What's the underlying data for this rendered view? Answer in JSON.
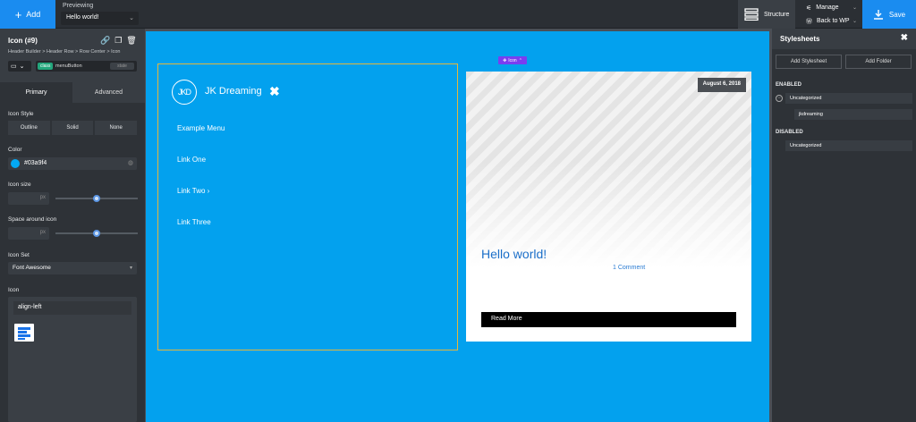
{
  "topbar": {
    "add_label": "Add",
    "previewing_label": "Previewing",
    "preview_value": "Hello world!",
    "structure_label": "Structure",
    "manage_label": "Manage",
    "back_label": "Back to WP",
    "save_label": "Save"
  },
  "left": {
    "title": "Icon (#9)",
    "breadcrumb": "Header Builder > Header Row > Row Center > Icon",
    "class_tag": "class",
    "class_value": "menuButton",
    "state_label": "state",
    "tabs": [
      "Primary",
      "Advanced"
    ],
    "icon_style_label": "Icon Style",
    "icon_style_options": [
      "Outline",
      "Solid",
      "None"
    ],
    "color_label": "Color",
    "color_value": "#03a9f4",
    "icon_size_label": "Icon size",
    "icon_size_unit": "px",
    "icon_size_level": 0.5,
    "space_label": "Space around icon",
    "space_unit": "px",
    "space_level": 0.5,
    "icon_set_label": "Icon Set",
    "icon_set_value": "Font Awesome",
    "icon_label": "Icon",
    "icon_search_value": "align-left"
  },
  "canvas": {
    "brand": "JK Dreaming",
    "logo_text": "JKD",
    "menu": [
      "Example Menu",
      "Link One",
      "Link Two",
      "Link Three"
    ],
    "selected_tag": "Icon",
    "post_date": "August 6, 2018",
    "post_title": "Hello world!",
    "post_comments": "1 Comment",
    "read_more": "Read More"
  },
  "right": {
    "title": "Stylesheets",
    "add_stylesheet": "Add Stylesheet",
    "add_folder": "Add Folder",
    "enabled_label": "ENABLED",
    "enabled_folder": "Uncategorized",
    "enabled_item": "jkdreaming",
    "disabled_label": "DISABLED",
    "disabled_folder": "Uncategorized"
  },
  "colors": {
    "accent": "#1a8cf0",
    "canvas_bg": "#03a1ee",
    "link": "#1b6fc9"
  }
}
